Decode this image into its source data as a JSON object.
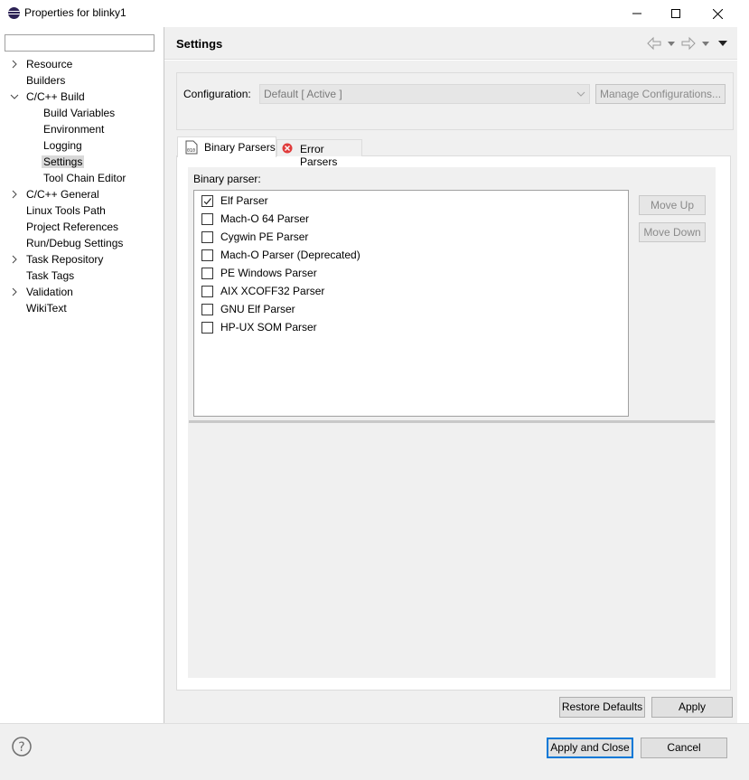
{
  "window": {
    "title": "Properties for blinky1"
  },
  "filter": {
    "value": "",
    "placeholder": ""
  },
  "tree": [
    {
      "label": "Resource",
      "expandable": true,
      "expanded": false,
      "level": 0
    },
    {
      "label": "Builders",
      "expandable": false,
      "level": 0
    },
    {
      "label": "C/C++ Build",
      "expandable": true,
      "expanded": true,
      "level": 0
    },
    {
      "label": "Build Variables",
      "expandable": false,
      "level": 1
    },
    {
      "label": "Environment",
      "expandable": false,
      "level": 1
    },
    {
      "label": "Logging",
      "expandable": false,
      "level": 1
    },
    {
      "label": "Settings",
      "expandable": false,
      "level": 1,
      "selected": true
    },
    {
      "label": "Tool Chain Editor",
      "expandable": false,
      "level": 1
    },
    {
      "label": "C/C++ General",
      "expandable": true,
      "expanded": false,
      "level": 0
    },
    {
      "label": "Linux Tools Path",
      "expandable": false,
      "level": 0
    },
    {
      "label": "Project References",
      "expandable": false,
      "level": 0
    },
    {
      "label": "Run/Debug Settings",
      "expandable": false,
      "level": 0
    },
    {
      "label": "Task Repository",
      "expandable": true,
      "expanded": false,
      "level": 0
    },
    {
      "label": "Task Tags",
      "expandable": false,
      "level": 0
    },
    {
      "label": "Validation",
      "expandable": true,
      "expanded": false,
      "level": 0
    },
    {
      "label": "WikiText",
      "expandable": false,
      "level": 0
    }
  ],
  "settings": {
    "title": "Settings",
    "configuration_label": "Configuration:",
    "configuration_value": "Default  [ Active ]",
    "manage_button": "Manage Configurations...",
    "tabs": [
      {
        "label": "Binary Parsers",
        "active": true,
        "icon": "binary-icon"
      },
      {
        "label": "Error Parsers",
        "active": false,
        "icon": "error-icon"
      }
    ],
    "binary_parser_label": "Binary parser:",
    "parsers": [
      {
        "label": "Elf Parser",
        "checked": true
      },
      {
        "label": "Mach-O 64 Parser",
        "checked": false
      },
      {
        "label": "Cygwin PE Parser",
        "checked": false
      },
      {
        "label": "Mach-O Parser (Deprecated)",
        "checked": false
      },
      {
        "label": "PE Windows Parser",
        "checked": false
      },
      {
        "label": "AIX XCOFF32 Parser",
        "checked": false
      },
      {
        "label": "GNU Elf Parser",
        "checked": false
      },
      {
        "label": "HP-UX SOM Parser",
        "checked": false
      }
    ],
    "move_up": "Move Up",
    "move_down": "Move Down",
    "restore_defaults": "Restore Defaults",
    "apply": "Apply"
  },
  "footer": {
    "apply_and_close": "Apply and Close",
    "cancel": "Cancel"
  }
}
